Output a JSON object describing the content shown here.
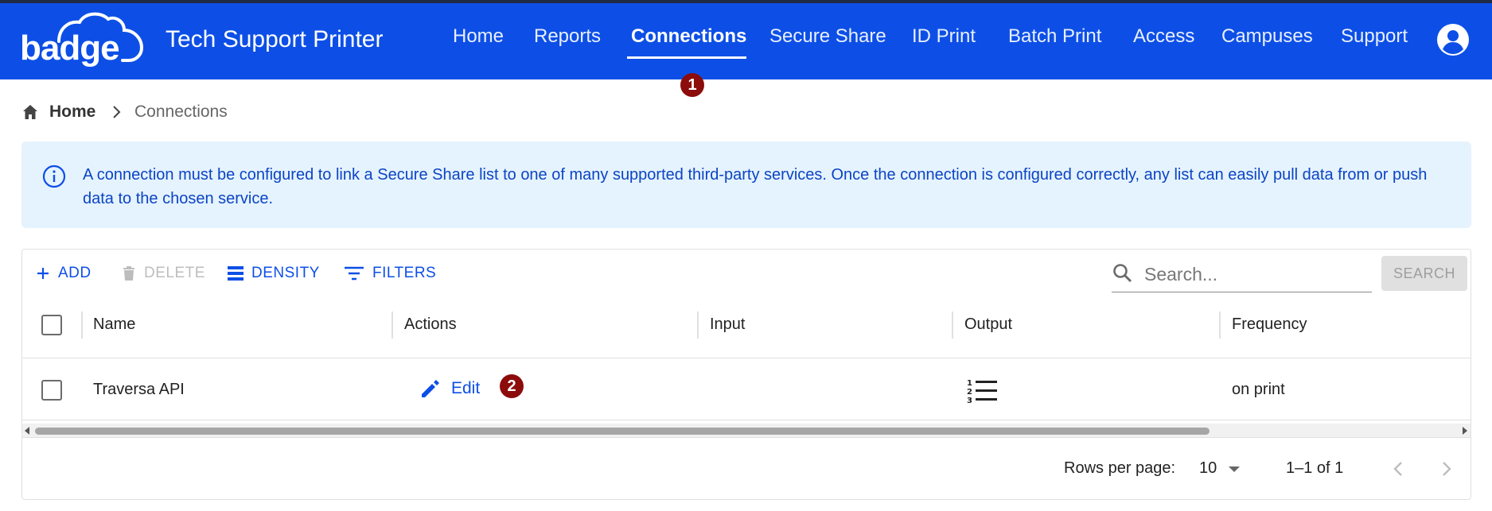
{
  "header": {
    "logo_text": "badge",
    "app_title": "Tech Support Printer",
    "nav": [
      {
        "label": "Home"
      },
      {
        "label": "Reports"
      },
      {
        "label": "Connections",
        "active": true
      },
      {
        "label": "Secure Share"
      },
      {
        "label": "ID Print"
      },
      {
        "label": "Batch Print"
      },
      {
        "label": "Access"
      },
      {
        "label": "Campuses"
      },
      {
        "label": "Support"
      }
    ],
    "bar_color": "#0d4fe6",
    "user_icon": "account-circle-icon"
  },
  "markers": [
    "1",
    "2"
  ],
  "breadcrumb": {
    "home": "Home",
    "current": "Connections"
  },
  "info": {
    "text": "A connection must be configured to link a Secure Share list to one of many supported third-party services. Once the connection is configured correctly, any list can easily pull data from or push data to the chosen service."
  },
  "toolbar": {
    "add": "ADD",
    "delete": "DELETE",
    "density": "DENSITY",
    "filters": "FILTERS",
    "search_placeholder": "Search...",
    "search_button": "SEARCH"
  },
  "table": {
    "columns": [
      "Name",
      "Actions",
      "Input",
      "Output",
      "Frequency"
    ],
    "rows": [
      {
        "name": "Traversa API",
        "action": "Edit",
        "input": "",
        "output_icon": "numbered-list-icon",
        "frequency": "on print"
      }
    ]
  },
  "pagination": {
    "rows_per_page_label": "Rows per page:",
    "rows_per_page_value": "10",
    "range": "1–1 of 1"
  }
}
